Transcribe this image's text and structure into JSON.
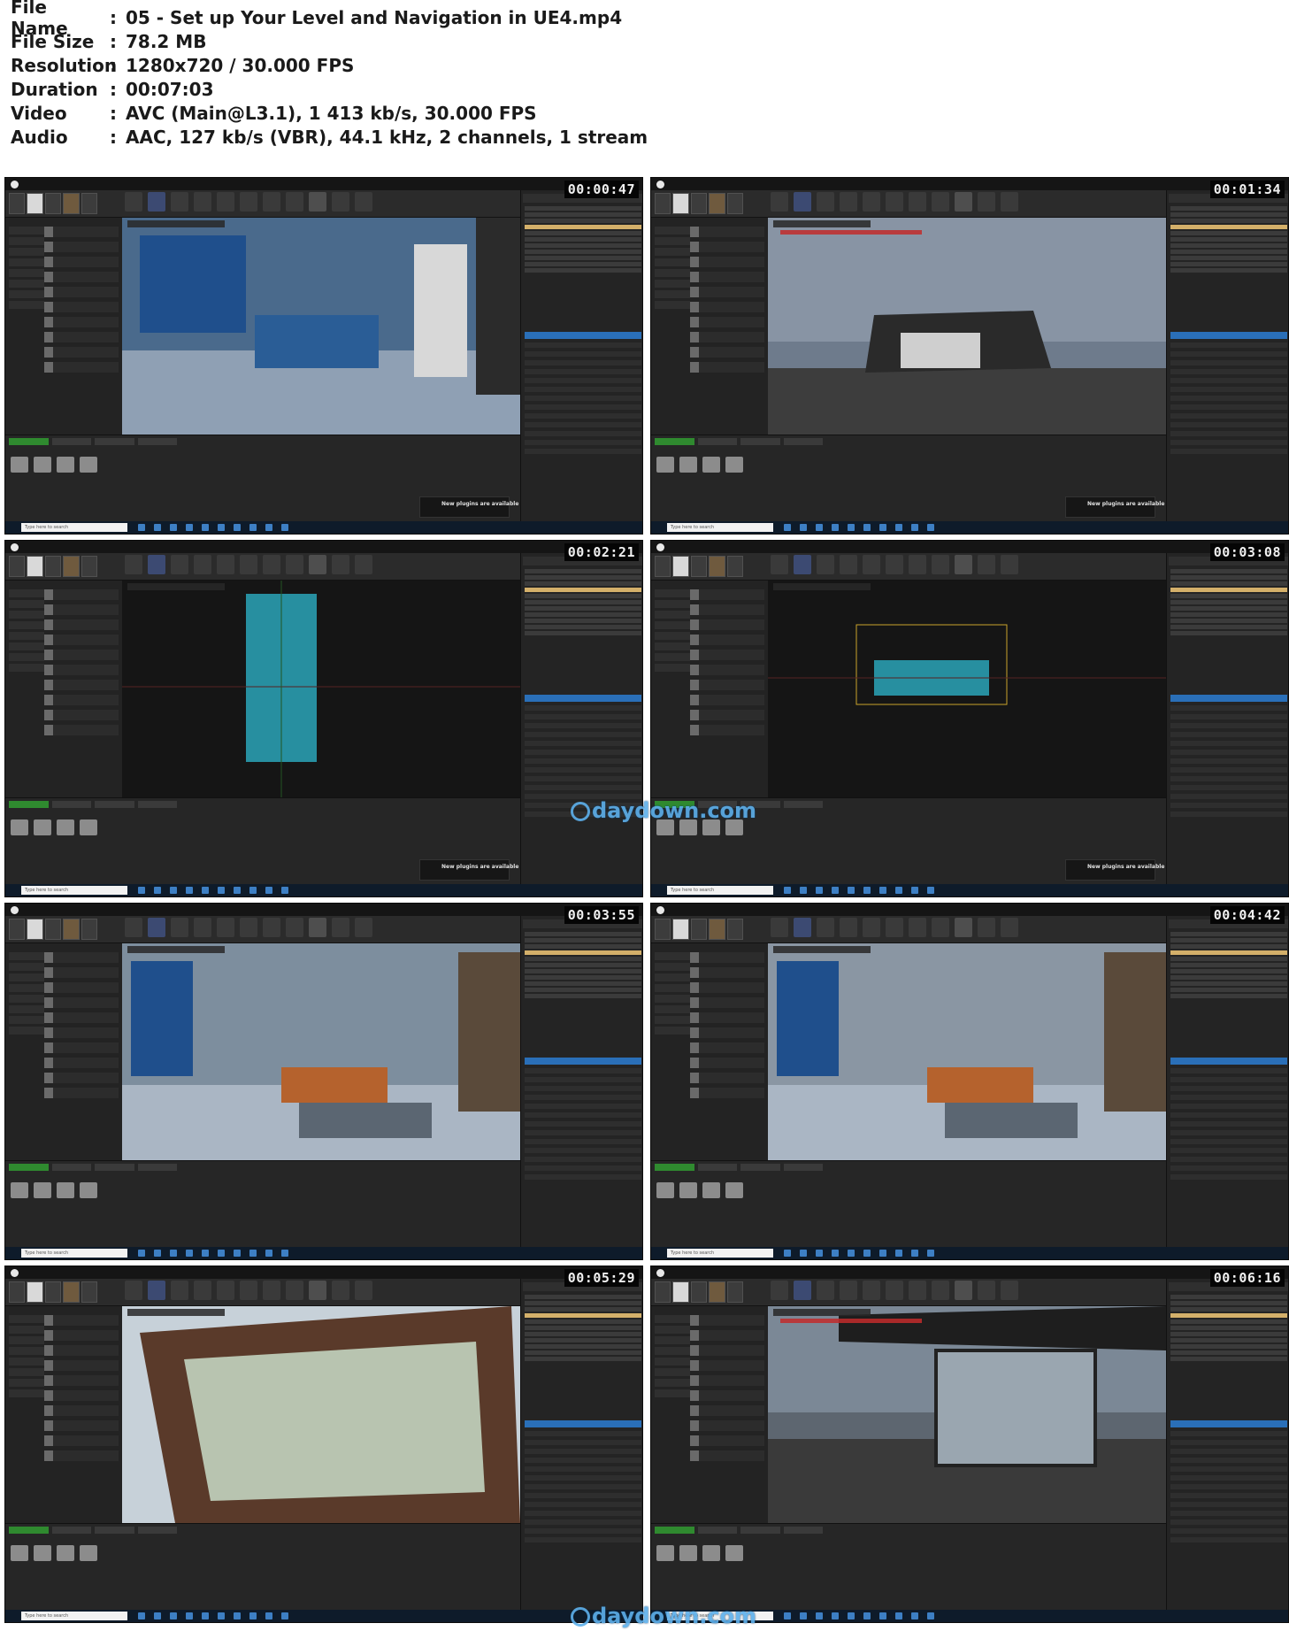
{
  "info": {
    "rows": [
      {
        "key": "File Name",
        "value": "05 - Set up Your Level and Navigation in UE4.mp4"
      },
      {
        "key": "File Size",
        "value": "78.2 MB"
      },
      {
        "key": "Resolution",
        "value": "1280x720 / 30.000 FPS"
      },
      {
        "key": "Duration",
        "value": "00:07:03"
      },
      {
        "key": "Video",
        "value": "AVC (Main@L3.1), 1 413 kb/s, 30.000 FPS"
      },
      {
        "key": "Audio",
        "value": "AAC, 127 kb/s (VBR), 44.1 kHz, 2 channels, 1 stream"
      }
    ],
    "colon": ":"
  },
  "thumbnails": [
    {
      "timestamp": "00:00:47",
      "scene": "interior",
      "bg": "#4a6a8c",
      "notification": "New plugins are available",
      "search": "Type here to search"
    },
    {
      "timestamp": "00:01:34",
      "scene": "exterior",
      "bg": "#6e7b8c",
      "notification": "New plugins are available",
      "search": "Type here to search"
    },
    {
      "timestamp": "00:02:21",
      "scene": "wireframe-top",
      "bg": "#151515",
      "notification": "New plugins are available",
      "search": "Type here to search"
    },
    {
      "timestamp": "00:03:08",
      "scene": "wireframe-side",
      "bg": "#151515",
      "notification": "New plugins are available",
      "search": "Type here to search"
    },
    {
      "timestamp": "00:03:55",
      "scene": "living-room",
      "bg": "#7d8e9e",
      "notification": "",
      "search": "Type here to search"
    },
    {
      "timestamp": "00:04:42",
      "scene": "living-room-2",
      "bg": "#8a96a3",
      "notification": "",
      "search": "Type here to search"
    },
    {
      "timestamp": "00:05:29",
      "scene": "mesh-editor",
      "bg": "#9aa59a",
      "notification": "",
      "search": "Type here to search"
    },
    {
      "timestamp": "00:06:16",
      "scene": "patio",
      "bg": "#5d6670",
      "notification": "",
      "search": "Type here to search"
    }
  ],
  "watermarks": [
    "daydown.com",
    "daydown.com"
  ],
  "colors": {
    "accent": "#5db0ec",
    "taskbar": "#0e1b2a",
    "editor_bg": "#1f1f1f"
  }
}
